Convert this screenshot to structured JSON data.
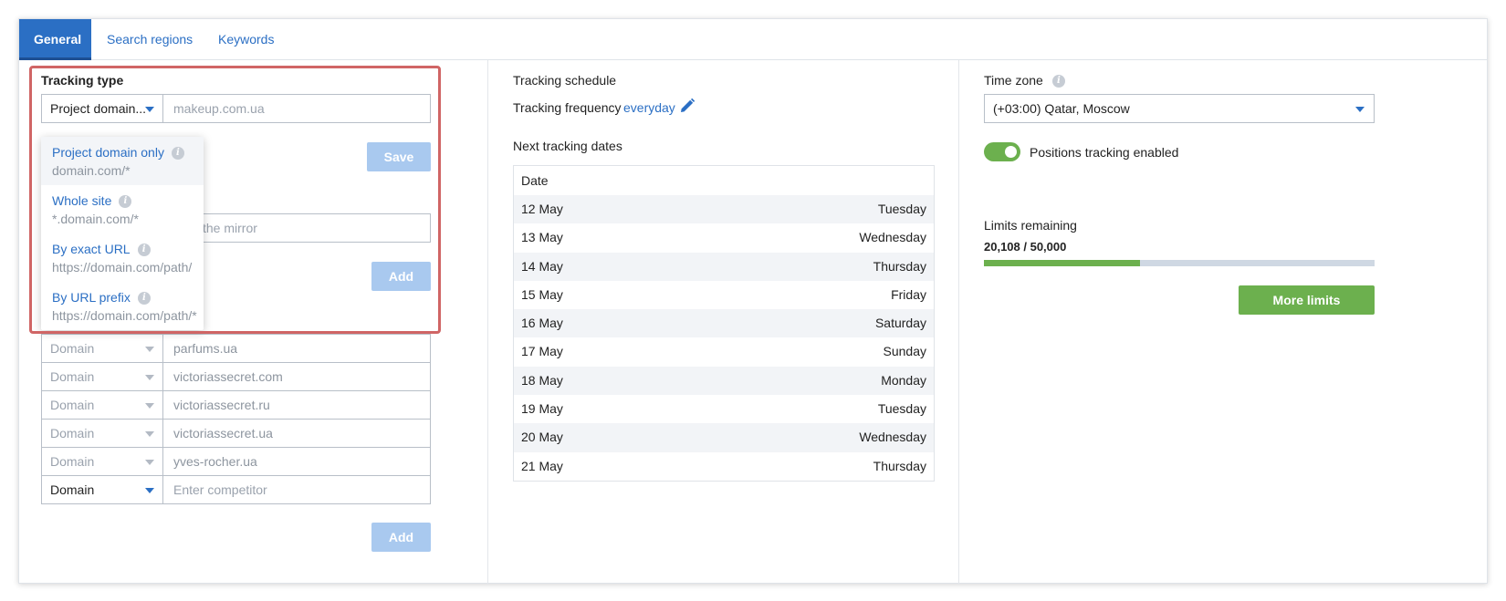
{
  "tabs": [
    {
      "label": "General",
      "active": true
    },
    {
      "label": "Search regions",
      "active": false
    },
    {
      "label": "Keywords",
      "active": false
    }
  ],
  "tracking_type": {
    "label": "Tracking type",
    "selected": "Project domain...",
    "domain_placeholder": "makeup.com.ua",
    "save_label": "Save",
    "dropdown_options": [
      {
        "title": "Project domain only",
        "pattern": "domain.com/*"
      },
      {
        "title": "Whole site",
        "pattern": "*.domain.com/*"
      },
      {
        "title": "By exact URL",
        "pattern": "https://domain.com/path/"
      },
      {
        "title": "By URL prefix",
        "pattern": "https://domain.com/path/*"
      }
    ]
  },
  "mirror": {
    "placeholder_visible": "the mirror",
    "add_label": "Add"
  },
  "competitors": {
    "rows": [
      {
        "type": "Domain",
        "value": "parfums.ua"
      },
      {
        "type": "Domain",
        "value": "victoriassecret.com"
      },
      {
        "type": "Domain",
        "value": "victoriassecret.ru"
      },
      {
        "type": "Domain",
        "value": "victoriassecret.ua"
      },
      {
        "type": "Domain",
        "value": "yves-rocher.ua"
      }
    ],
    "new_row": {
      "type": "Domain",
      "placeholder": "Enter competitor"
    },
    "add_label": "Add"
  },
  "schedule": {
    "title": "Tracking schedule",
    "frequency_label": "Tracking frequency",
    "frequency_value": "everyday",
    "next_dates_label": "Next tracking dates",
    "table_header": "Date",
    "dates": [
      {
        "date": "12 May",
        "day": "Tuesday"
      },
      {
        "date": "13 May",
        "day": "Wednesday"
      },
      {
        "date": "14 May",
        "day": "Thursday"
      },
      {
        "date": "15 May",
        "day": "Friday"
      },
      {
        "date": "16 May",
        "day": "Saturday"
      },
      {
        "date": "17 May",
        "day": "Sunday"
      },
      {
        "date": "18 May",
        "day": "Monday"
      },
      {
        "date": "19 May",
        "day": "Tuesday"
      },
      {
        "date": "20 May",
        "day": "Wednesday"
      },
      {
        "date": "21 May",
        "day": "Thursday"
      }
    ]
  },
  "settings": {
    "timezone_label": "Time zone",
    "timezone_value": "(+03:00) Qatar, Moscow",
    "positions_tracking_label": "Positions tracking enabled",
    "positions_tracking_enabled": true,
    "limits_label": "Limits remaining",
    "limits_text": "20,108 / 50,000",
    "limits_used_fraction": 0.4,
    "more_limits_label": "More limits"
  },
  "colors": {
    "accent": "#2b6fc4",
    "green": "#6cb04e",
    "highlight": "#d06565"
  }
}
